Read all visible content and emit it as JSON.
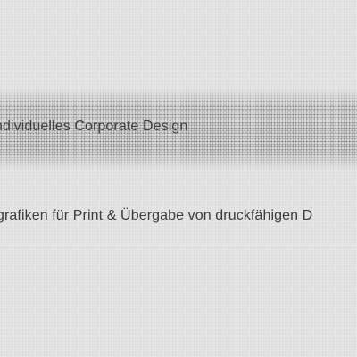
{
  "service_item": {
    "title": "ndividuelles Corporate Design",
    "description": "grafiken für Print & Übergabe von druckfähigen D"
  }
}
